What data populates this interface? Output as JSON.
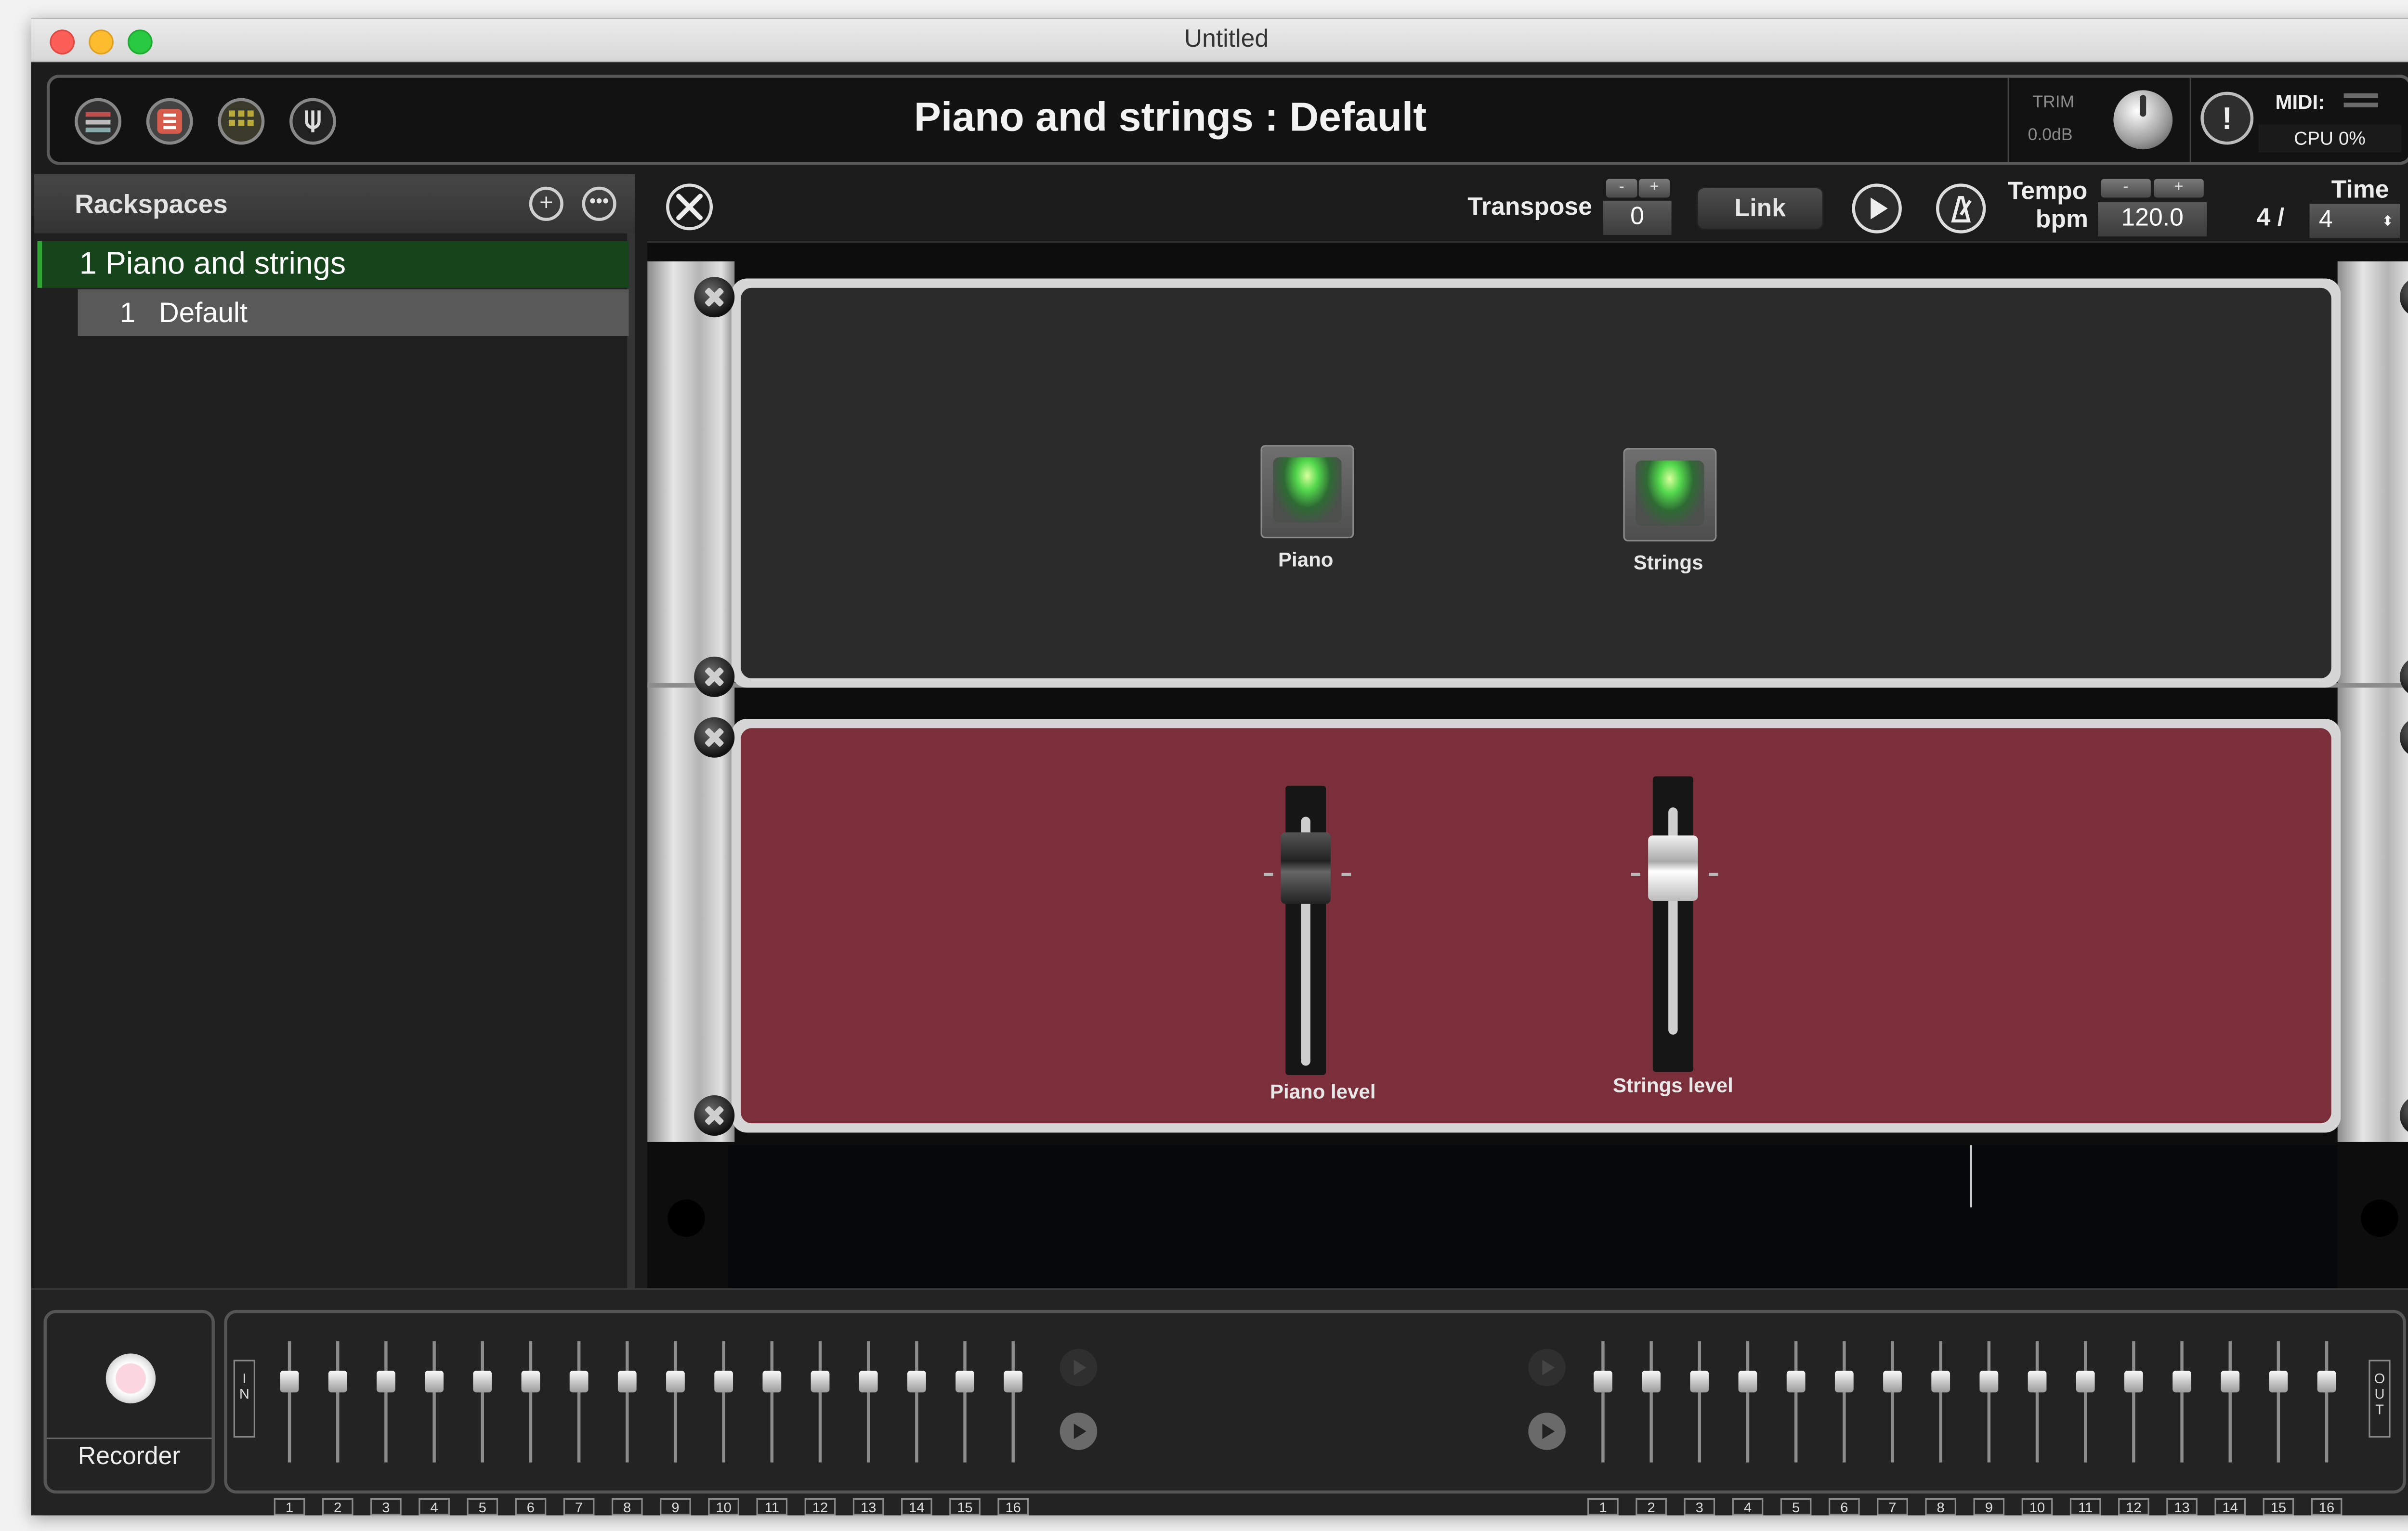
{
  "window": {
    "title": "Untitled"
  },
  "toolbar": {
    "title": "Piano and strings : Default",
    "icons": [
      "rack-view-icon",
      "setlist-icon",
      "mixer-view-icon",
      "tuner-icon"
    ],
    "trim_label": "TRIM",
    "trim_value": "0.0dB",
    "midi_label": "MIDI:",
    "cpu_label": "CPU 0%"
  },
  "sidebar": {
    "title": "Rackspaces",
    "rackspaces": [
      {
        "label": "1 Piano and strings",
        "variations": [
          {
            "number": "1",
            "label": "Default"
          }
        ]
      }
    ]
  },
  "rack_toolbar": {
    "transpose_label": "Transpose",
    "transpose_value": "0",
    "stepper_minus": "-",
    "stepper_plus": "+",
    "link_label": "Link",
    "tempo_label": "Tempo",
    "bpm_label": "bpm",
    "tempo_value": "120.0",
    "time_label": "Time",
    "time_numerator": "4 /",
    "time_denominator": "4"
  },
  "panels": {
    "buttons": [
      {
        "label": "Piano",
        "on": true
      },
      {
        "label": "Strings",
        "on": true
      }
    ],
    "faders": [
      {
        "label": "Piano level"
      },
      {
        "label": "Strings level"
      }
    ],
    "colors": {
      "panel_dark": "#2b2b2b",
      "panel_red": "#7a2f3a",
      "led_green": "#54d94d"
    }
  },
  "recorder": {
    "label": "Recorder"
  },
  "mixer": {
    "in_label": "I\nN",
    "out_label": "O\nU\nT",
    "input_channels": [
      "1",
      "2",
      "3",
      "4",
      "5",
      "6",
      "7",
      "8",
      "9",
      "10",
      "11",
      "12",
      "13",
      "14",
      "15",
      "16"
    ],
    "output_channels": [
      "1",
      "2",
      "3",
      "4",
      "5",
      "6",
      "7",
      "8",
      "9",
      "10",
      "11",
      "12",
      "13",
      "14",
      "15",
      "16"
    ]
  }
}
